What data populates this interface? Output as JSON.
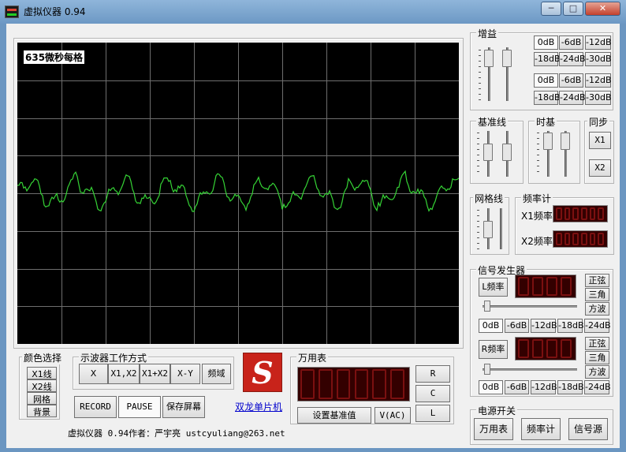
{
  "window": {
    "title": "虚拟仪器 0.94",
    "minimize": "─",
    "maximize": "□",
    "close": "✕"
  },
  "scope": {
    "label": "635微秒每格"
  },
  "color_select": {
    "title": "颜色选择",
    "items": [
      "X1线",
      "X2线",
      "网格",
      "背景"
    ]
  },
  "mode": {
    "title": "示波器工作方式",
    "buttons": [
      "X",
      "X1,X2",
      "X1+X2",
      "X-Y",
      "频域"
    ]
  },
  "record": {
    "record": "RECORD",
    "pause": "PAUSE",
    "save": "保存屏幕"
  },
  "logo": {
    "link": "双龙单片机",
    "glyph": "S"
  },
  "multimeter": {
    "title": "万用表",
    "r": "R",
    "c": "C",
    "l": "L",
    "set_base": "设置基准值",
    "vac": "V(AC)"
  },
  "footer": {
    "author": "虚拟仪器 0.94作者：严宇亮  ustcyuliang@263.net"
  },
  "gain": {
    "title": "增益",
    "row1": [
      "0dB",
      "-6dB",
      "-12dB"
    ],
    "row2": [
      "-18dB",
      "-24dB",
      "-30dB"
    ]
  },
  "baseline": {
    "title": "基准线"
  },
  "timebase": {
    "title": "时基"
  },
  "sync": {
    "title": "同步",
    "x1": "X1",
    "x2": "X2"
  },
  "gridline": {
    "title": "网格线"
  },
  "freq": {
    "title": "频率计",
    "x1": "X1频率",
    "x2": "X2频率"
  },
  "siggen": {
    "title": "信号发生器",
    "l_freq": "L频率",
    "r_freq": "R频率",
    "waves": [
      "正弦",
      "三角",
      "方波"
    ],
    "atten": [
      "0dB",
      "-6dB",
      "-12dB",
      "-18dB",
      "-24dB"
    ]
  },
  "power": {
    "title": "电源开关",
    "buttons": [
      "万用表",
      "频率计",
      "信号源"
    ]
  },
  "colors": {
    "trace": "#35d335",
    "grid": "#6e6e6e",
    "led_bg": "#2a0000",
    "led_seg": "#7a1010",
    "window": "#6b96c1"
  }
}
